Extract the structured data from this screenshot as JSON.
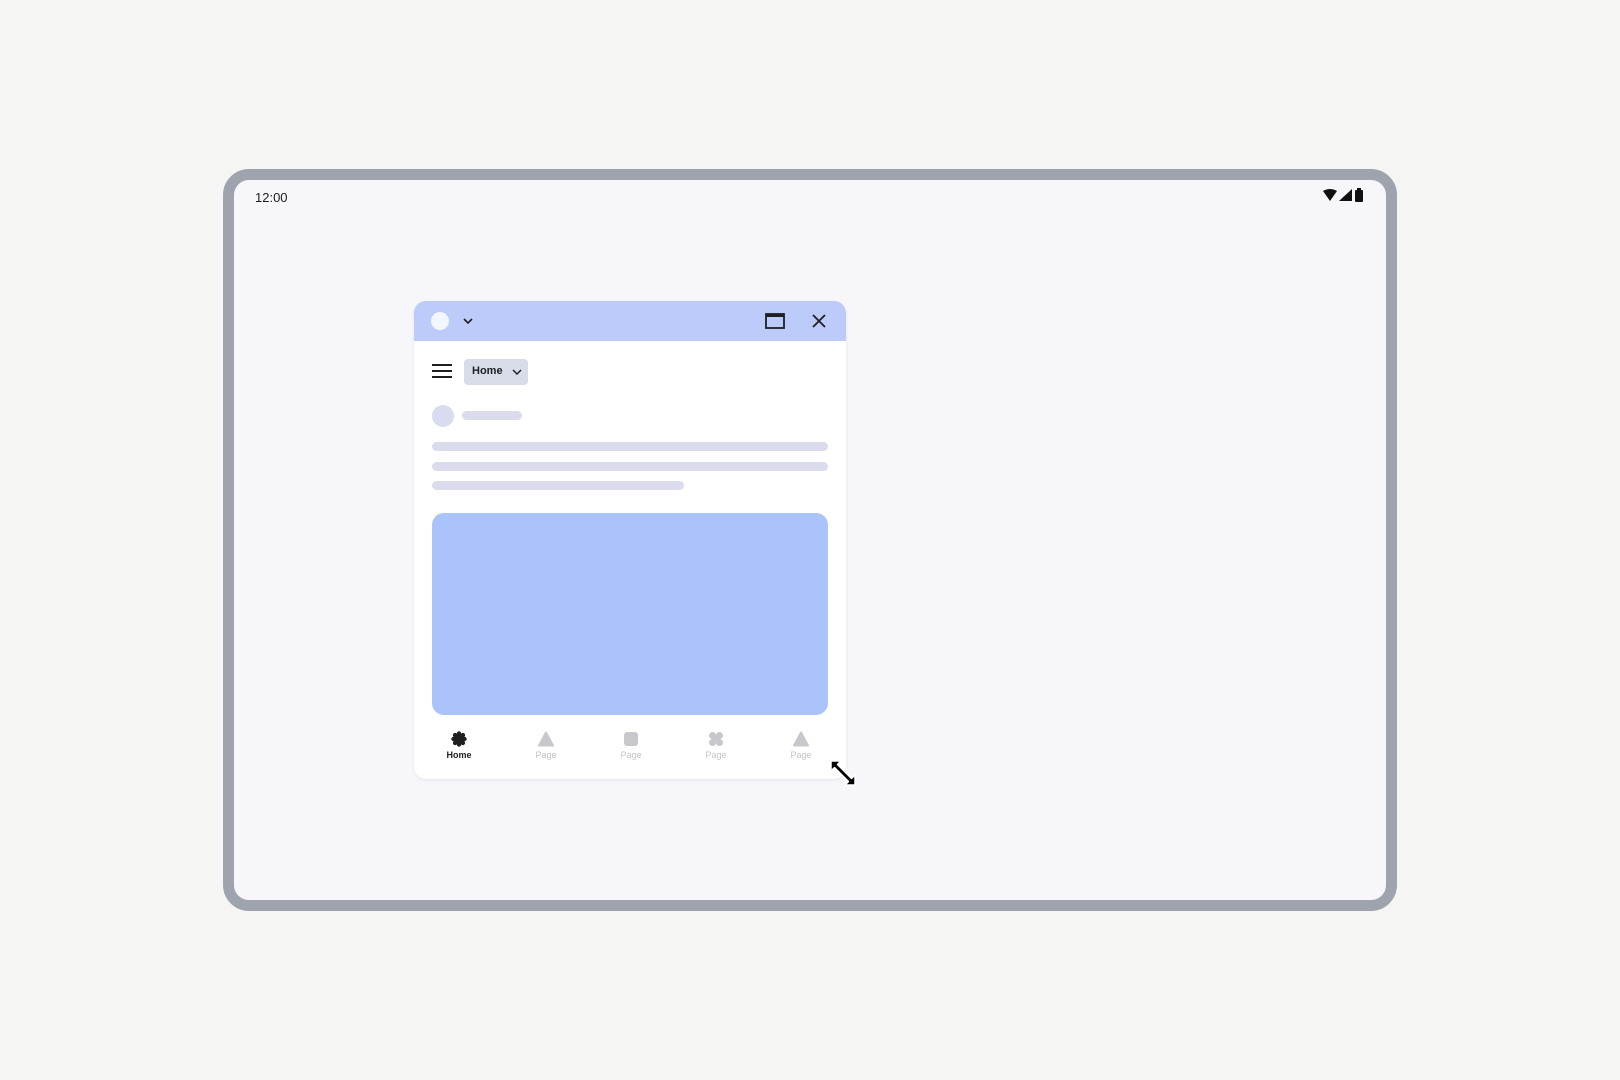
{
  "status_bar": {
    "time": "12:00",
    "icons": [
      "wifi-icon",
      "cellular-signal-icon",
      "battery-icon"
    ]
  },
  "window": {
    "titlebar": {
      "color": "#bccbfa",
      "icons": [
        "app-icon",
        "chevron-down-icon",
        "maximize-icon",
        "close-icon"
      ]
    },
    "toolbar": {
      "menu_icon": "menu-icon",
      "dropdown_label": "Home"
    },
    "hero_color": "#aac4fb",
    "bottom_nav": [
      {
        "label": "Home",
        "icon": "flower-icon",
        "active": true
      },
      {
        "label": "Page",
        "icon": "triangle-icon",
        "active": false
      },
      {
        "label": "Page",
        "icon": "square-icon",
        "active": false
      },
      {
        "label": "Page",
        "icon": "clover-icon",
        "active": false
      },
      {
        "label": "Page",
        "icon": "triangle-icon",
        "active": false
      }
    ]
  },
  "cursor": "diagonal-resize-cursor-icon"
}
